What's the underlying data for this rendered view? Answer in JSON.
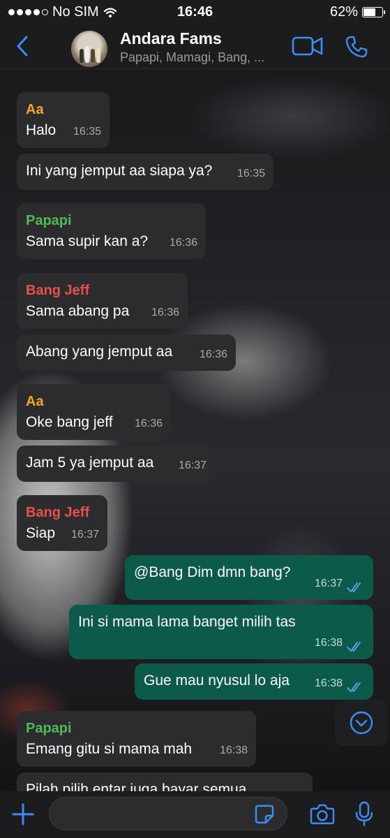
{
  "status_bar": {
    "carrier": "No SIM",
    "time": "16:46",
    "battery": "62%",
    "battery_level": 0.62
  },
  "header": {
    "title": "Andara Fams",
    "subtitle": "Papapi, Mamagi, Bang, ...",
    "back_icon": "chevron-left-icon",
    "video_icon": "video-call-icon",
    "call_icon": "phone-icon"
  },
  "colors": {
    "accent": "#3a8ef6",
    "incoming": "#2c2c2e",
    "outgoing": "#0b5a4a",
    "sender_orange": "#f5a623",
    "sender_green": "#4cbb58",
    "sender_red": "#e5534b",
    "read_ticks": "#5aa9f0"
  },
  "messages": [
    {
      "direction": "in",
      "sender": "Aa",
      "text": "Halo",
      "time": "16:35"
    },
    {
      "direction": "in",
      "sender": "",
      "text": "Ini yang jemput aa siapa ya?",
      "time": "16:35"
    },
    {
      "direction": "in",
      "sender": "Papapi",
      "text": "Sama supir kan a?",
      "time": "16:36"
    },
    {
      "direction": "in",
      "sender": "Bang Jeff",
      "text": "Sama abang pa",
      "time": "16:36"
    },
    {
      "direction": "in",
      "sender": "",
      "text": "Abang yang jemput aa",
      "time": "16:36"
    },
    {
      "direction": "in",
      "sender": "Aa",
      "text": "Oke bang jeff",
      "time": "16:36"
    },
    {
      "direction": "in",
      "sender": "",
      "text": "Jam 5 ya jemput aa",
      "time": "16:37"
    },
    {
      "direction": "in",
      "sender": "Bang Jeff",
      "text": "Siap",
      "time": "16:37"
    },
    {
      "direction": "out",
      "sender": "",
      "text": "@Bang Dim dmn bang?",
      "time": "16:37"
    },
    {
      "direction": "out",
      "sender": "",
      "text": "Ini si mama lama banget milih tas",
      "time": "16:38"
    },
    {
      "direction": "out",
      "sender": "",
      "text": "Gue mau nyusul lo aja",
      "time": "16:38"
    },
    {
      "direction": "in",
      "sender": "Papapi",
      "text": "Emang gitu si mama mah",
      "time": "16:38"
    },
    {
      "direction": "in",
      "sender": "",
      "text": "Pilah pilih entar juga bayar semua",
      "time": ""
    }
  ],
  "composer": {
    "value": "",
    "placeholder": "",
    "plus_icon": "plus-icon",
    "sticker_icon": "sticker-icon",
    "camera_icon": "camera-icon",
    "mic_icon": "microphone-icon"
  },
  "scroll_button_icon": "chevron-down-circle-icon"
}
